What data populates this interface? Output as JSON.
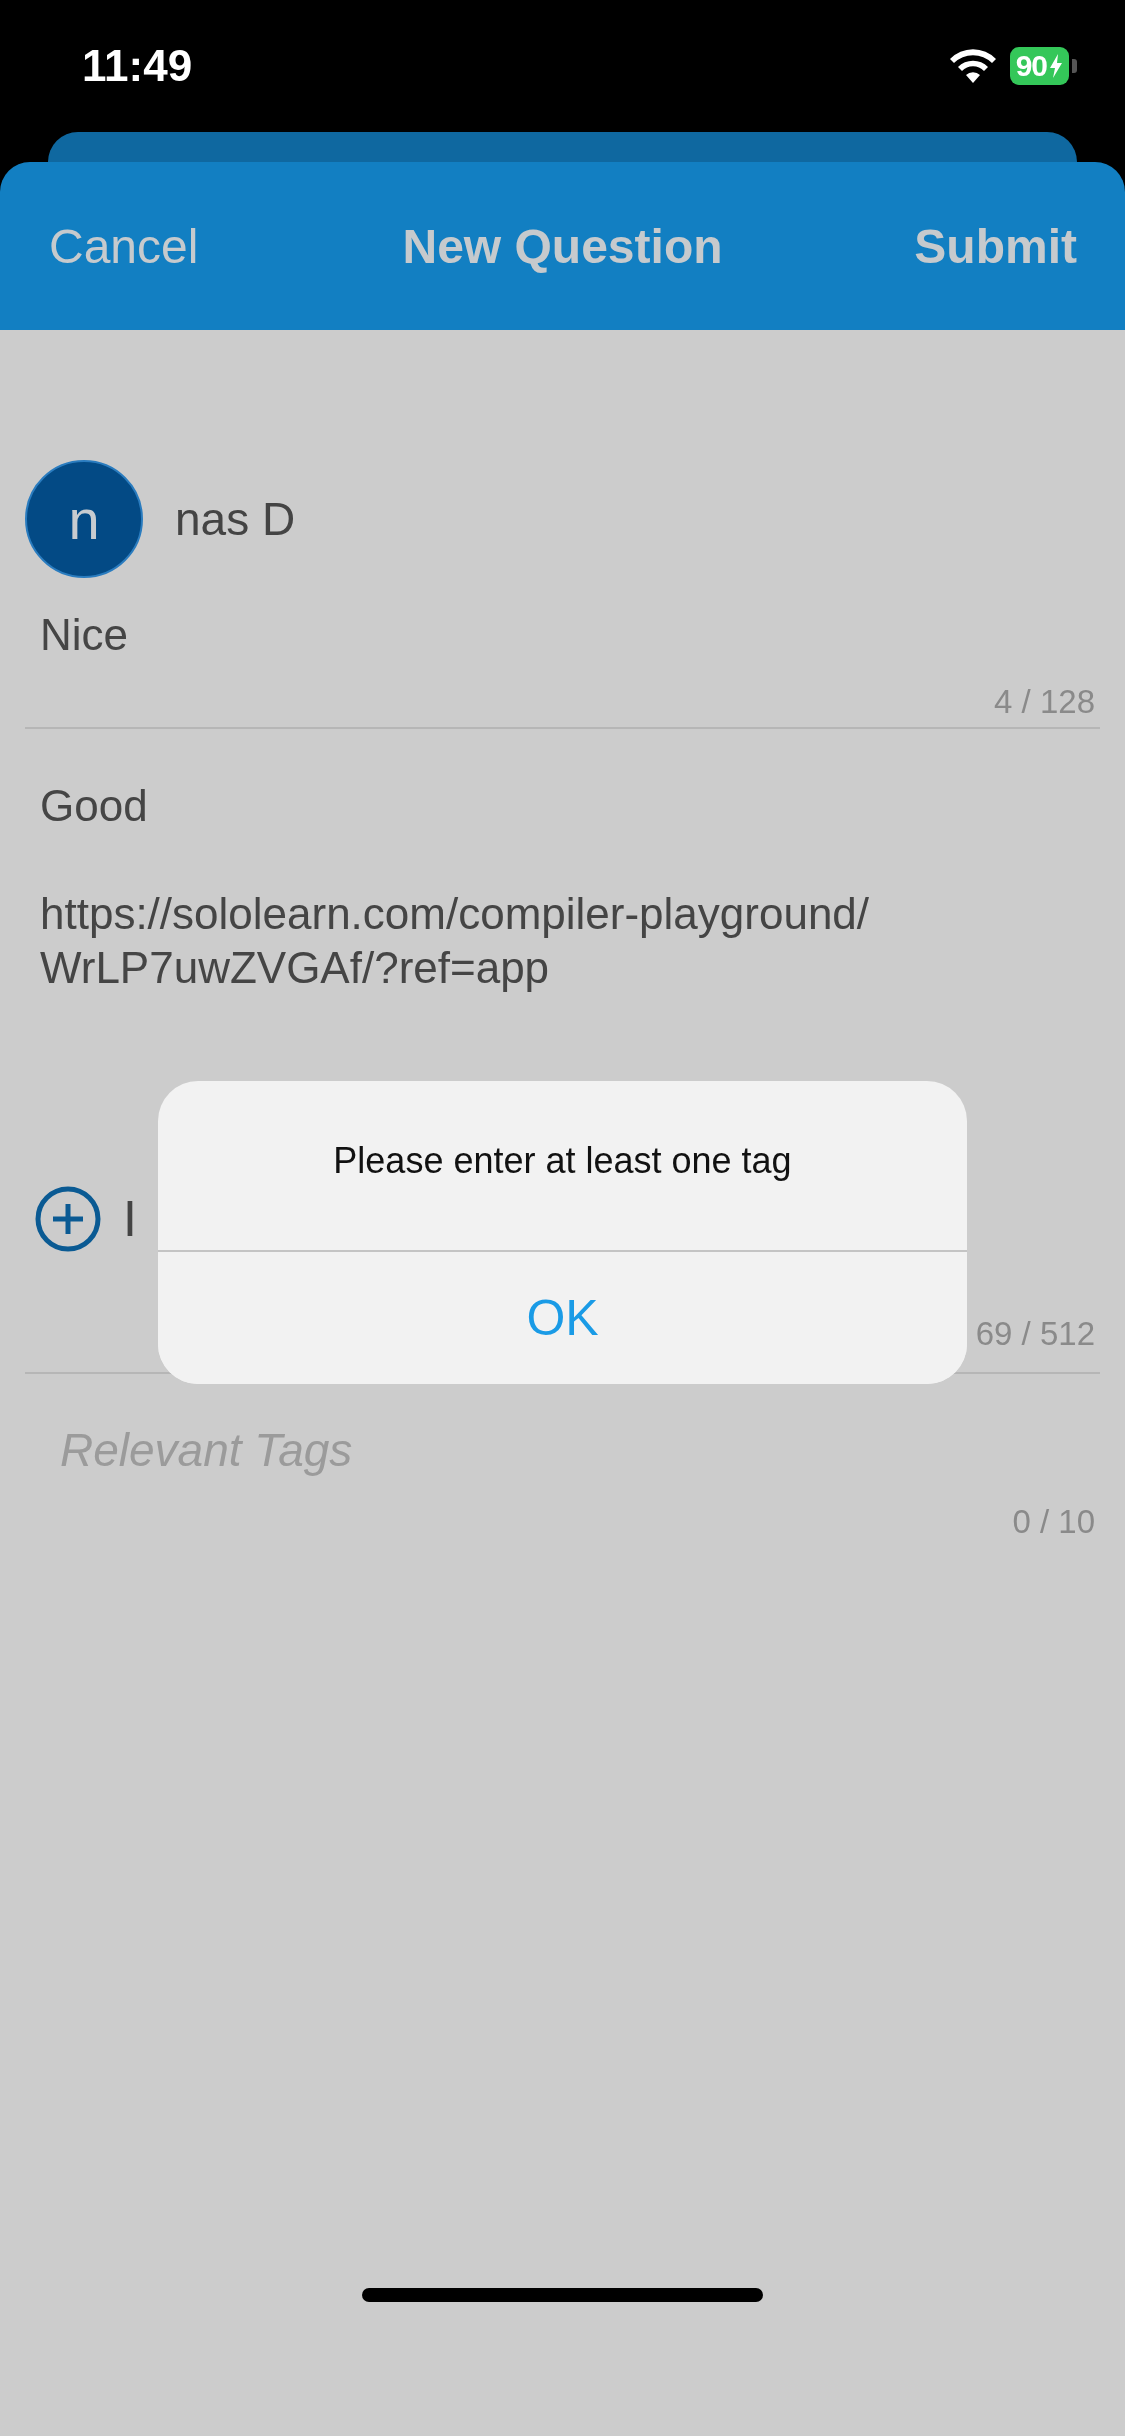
{
  "status_bar": {
    "time": "11:49",
    "battery": "90"
  },
  "nav": {
    "cancel": "Cancel",
    "title": "New Question",
    "submit": "Submit"
  },
  "author": {
    "initial": "n",
    "name": "nas D"
  },
  "title_field": {
    "value": "Nice",
    "counter": "4 / 128"
  },
  "body_field": {
    "value": "Good\n\nhttps://sololearn.com/compiler-playground/\nWrLP7uwZVGAf/?ref=app",
    "insert_label": "I",
    "counter": "69 / 512"
  },
  "tags_field": {
    "placeholder": "Relevant Tags",
    "counter": "0 / 10"
  },
  "alert": {
    "message": "Please enter at least one tag",
    "buttons": [
      "OK"
    ]
  }
}
